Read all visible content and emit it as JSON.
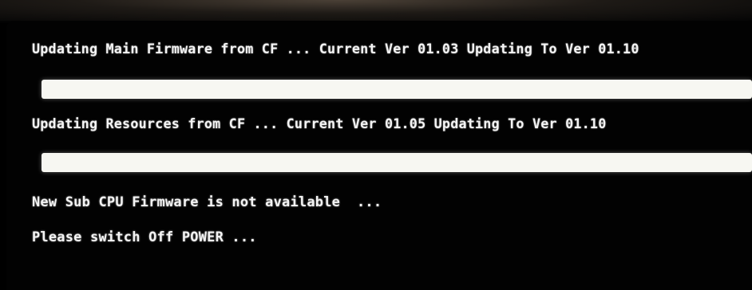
{
  "console": {
    "line_main_firmware": "Updating Main Firmware from CF ... Current Ver 01.03 Updating To Ver 01.10",
    "line_resources": "Updating Resources from CF ... Current Ver 01.05 Updating To Ver 01.10",
    "line_sub_cpu": "New Sub CPU Firmware is not available  ...",
    "line_power": "Please switch Off POWER ..."
  },
  "progress": {
    "main_firmware": 1.0,
    "resources": 1.0
  },
  "colors": {
    "background": "#000000",
    "text": "#f4f4f4",
    "progress_fill": "#f7f7f2"
  }
}
